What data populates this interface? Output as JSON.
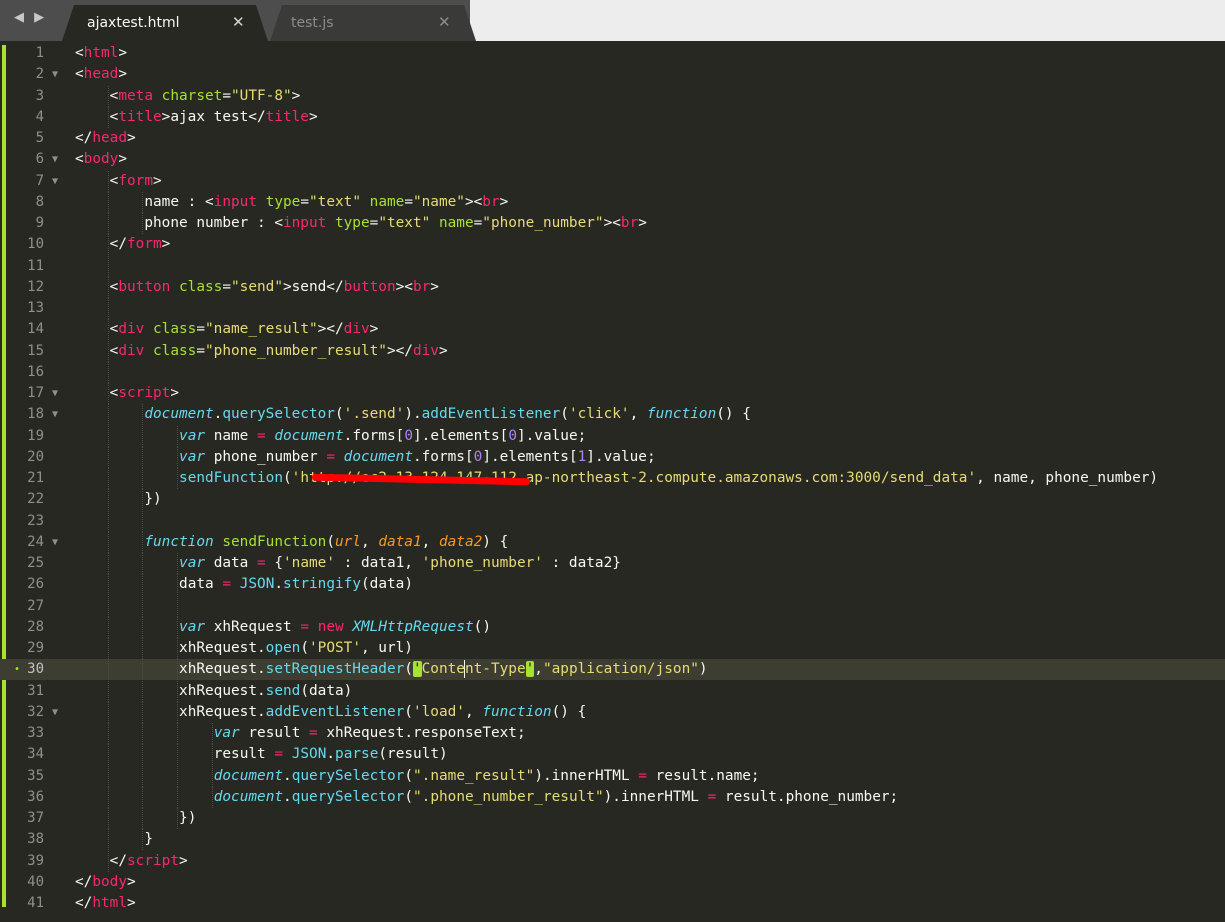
{
  "tabs": [
    {
      "label": "ajaxtest.html",
      "active": true
    },
    {
      "label": "test.js",
      "active": false
    }
  ],
  "nav_arrows": "◀ ▶",
  "close_glyph": "✕",
  "fold_glyph": "▼",
  "modified_glyph": "•",
  "colors": {
    "background": "#272822",
    "tag": "#f92672",
    "attribute": "#a6e22e",
    "string": "#e6db74",
    "keyword": "#66d9ef",
    "parameter": "#fd971f",
    "number": "#ae81ff",
    "text": "#f8f8f2"
  },
  "lines": [
    {
      "n": "1"
    },
    {
      "n": "2"
    },
    {
      "n": "3"
    },
    {
      "n": "4"
    },
    {
      "n": "5"
    },
    {
      "n": "6"
    },
    {
      "n": "7"
    },
    {
      "n": "8"
    },
    {
      "n": "9"
    },
    {
      "n": "10"
    },
    {
      "n": "11"
    },
    {
      "n": "12"
    },
    {
      "n": "13"
    },
    {
      "n": "14"
    },
    {
      "n": "15"
    },
    {
      "n": "16"
    },
    {
      "n": "17"
    },
    {
      "n": "18"
    },
    {
      "n": "19"
    },
    {
      "n": "20"
    },
    {
      "n": "21"
    },
    {
      "n": "22"
    },
    {
      "n": "23"
    },
    {
      "n": "24"
    },
    {
      "n": "25"
    },
    {
      "n": "26"
    },
    {
      "n": "27"
    },
    {
      "n": "28"
    },
    {
      "n": "29"
    },
    {
      "n": "30"
    },
    {
      "n": "31"
    },
    {
      "n": "32"
    },
    {
      "n": "33"
    },
    {
      "n": "34"
    },
    {
      "n": "35"
    },
    {
      "n": "36"
    },
    {
      "n": "37"
    },
    {
      "n": "38"
    },
    {
      "n": "39"
    },
    {
      "n": "40"
    },
    {
      "n": "41"
    }
  ],
  "code": {
    "l1": [
      [
        "p",
        "<"
      ],
      [
        "t",
        "html"
      ],
      [
        "p",
        ">"
      ]
    ],
    "l2": [
      [
        "p",
        "<"
      ],
      [
        "t",
        "head"
      ],
      [
        "p",
        ">"
      ]
    ],
    "l3": [
      [
        "p",
        "<"
      ],
      [
        "t",
        "meta"
      ],
      [
        "p",
        " "
      ],
      [
        "a",
        "charset"
      ],
      [
        "p",
        "="
      ],
      [
        "s",
        "\"UTF-8\""
      ],
      [
        "p",
        ">"
      ]
    ],
    "l4": [
      [
        "p",
        "<"
      ],
      [
        "t",
        "title"
      ],
      [
        "p",
        ">ajax test</"
      ],
      [
        "t",
        "title"
      ],
      [
        "p",
        ">"
      ]
    ],
    "l5": [
      [
        "p",
        "</"
      ],
      [
        "t",
        "head"
      ],
      [
        "p",
        ">"
      ]
    ],
    "l6": [
      [
        "p",
        "<"
      ],
      [
        "t",
        "body"
      ],
      [
        "p",
        ">"
      ]
    ],
    "l7": [
      [
        "p",
        "<"
      ],
      [
        "t",
        "form"
      ],
      [
        "p",
        ">"
      ]
    ],
    "l8": [
      [
        "p",
        "name : <"
      ],
      [
        "t",
        "input"
      ],
      [
        "p",
        " "
      ],
      [
        "a",
        "type"
      ],
      [
        "p",
        "="
      ],
      [
        "s",
        "\"text\""
      ],
      [
        "p",
        " "
      ],
      [
        "a",
        "name"
      ],
      [
        "p",
        "="
      ],
      [
        "s",
        "\"name\""
      ],
      [
        "p",
        "><"
      ],
      [
        "t",
        "br"
      ],
      [
        "p",
        ">"
      ]
    ],
    "l9": [
      [
        "p",
        "phone number : <"
      ],
      [
        "t",
        "input"
      ],
      [
        "p",
        " "
      ],
      [
        "a",
        "type"
      ],
      [
        "p",
        "="
      ],
      [
        "s",
        "\"text\""
      ],
      [
        "p",
        " "
      ],
      [
        "a",
        "name"
      ],
      [
        "p",
        "="
      ],
      [
        "s",
        "\"phone_number\""
      ],
      [
        "p",
        "><"
      ],
      [
        "t",
        "br"
      ],
      [
        "p",
        ">"
      ]
    ],
    "l10": [
      [
        "p",
        "</"
      ],
      [
        "t",
        "form"
      ],
      [
        "p",
        ">"
      ]
    ],
    "l12": [
      [
        "p",
        "<"
      ],
      [
        "t",
        "button"
      ],
      [
        "p",
        " "
      ],
      [
        "a",
        "class"
      ],
      [
        "p",
        "="
      ],
      [
        "s",
        "\"send\""
      ],
      [
        "p",
        ">send</"
      ],
      [
        "t",
        "button"
      ],
      [
        "p",
        "><"
      ],
      [
        "t",
        "br"
      ],
      [
        "p",
        ">"
      ]
    ],
    "l14": [
      [
        "p",
        "<"
      ],
      [
        "t",
        "div"
      ],
      [
        "p",
        " "
      ],
      [
        "a",
        "class"
      ],
      [
        "p",
        "="
      ],
      [
        "s",
        "\"name_result\""
      ],
      [
        "p",
        "></"
      ],
      [
        "t",
        "div"
      ],
      [
        "p",
        ">"
      ]
    ],
    "l15": [
      [
        "p",
        "<"
      ],
      [
        "t",
        "div"
      ],
      [
        "p",
        " "
      ],
      [
        "a",
        "class"
      ],
      [
        "p",
        "="
      ],
      [
        "s",
        "\"phone_number_result\""
      ],
      [
        "p",
        "></"
      ],
      [
        "t",
        "div"
      ],
      [
        "p",
        ">"
      ]
    ],
    "l17": [
      [
        "p",
        "<"
      ],
      [
        "t",
        "script"
      ],
      [
        "p",
        ">"
      ]
    ],
    "l18": [
      [
        "k",
        "document"
      ],
      [
        "p",
        "."
      ],
      [
        "f",
        "querySelector"
      ],
      [
        "p",
        "("
      ],
      [
        "s",
        "'.send'"
      ],
      [
        "p",
        ")."
      ],
      [
        "f",
        "addEventListener"
      ],
      [
        "p",
        "("
      ],
      [
        "s",
        "'click'"
      ],
      [
        "p",
        ", "
      ],
      [
        "k",
        "function"
      ],
      [
        "p",
        "() {"
      ]
    ],
    "l19": [
      [
        "k",
        "var"
      ],
      [
        "p",
        " name "
      ],
      [
        "o",
        "="
      ],
      [
        "p",
        " "
      ],
      [
        "k",
        "document"
      ],
      [
        "p",
        ".forms["
      ],
      [
        "n",
        "0"
      ],
      [
        "p",
        "].elements["
      ],
      [
        "n",
        "0"
      ],
      [
        "p",
        "].value;"
      ]
    ],
    "l20": [
      [
        "k",
        "var"
      ],
      [
        "p",
        " phone_number "
      ],
      [
        "o",
        "="
      ],
      [
        "p",
        " "
      ],
      [
        "k",
        "document"
      ],
      [
        "p",
        ".forms["
      ],
      [
        "n",
        "0"
      ],
      [
        "p",
        "].elements["
      ],
      [
        "n",
        "1"
      ],
      [
        "p",
        "].value;"
      ]
    ],
    "l21": [
      [
        "f",
        "sendFunction"
      ],
      [
        "p",
        "("
      ],
      [
        "s",
        "'http://ec2-13-124-147-112.ap-northeast-2.compute.amazonaws.com:3000/send_data'"
      ],
      [
        "p",
        ", name, phone_number)"
      ]
    ],
    "l22": [
      [
        "p",
        "})"
      ]
    ],
    "l24": [
      [
        "k",
        "function"
      ],
      [
        "p",
        " "
      ],
      [
        "a",
        "sendFunction"
      ],
      [
        "p",
        "("
      ],
      [
        "pa",
        "url"
      ],
      [
        "p",
        ", "
      ],
      [
        "pa",
        "data1"
      ],
      [
        "p",
        ", "
      ],
      [
        "pa",
        "data2"
      ],
      [
        "p",
        ") {"
      ]
    ],
    "l25": [
      [
        "k",
        "var"
      ],
      [
        "p",
        " data "
      ],
      [
        "o",
        "="
      ],
      [
        "p",
        " {"
      ],
      [
        "s",
        "'name'"
      ],
      [
        "p",
        " : data1, "
      ],
      [
        "s",
        "'phone_number'"
      ],
      [
        "p",
        " : data2}"
      ]
    ],
    "l26": [
      [
        "p",
        "data "
      ],
      [
        "o",
        "="
      ],
      [
        "p",
        " "
      ],
      [
        "f",
        "JSON"
      ],
      [
        "p",
        "."
      ],
      [
        "f",
        "stringify"
      ],
      [
        "p",
        "(data)"
      ]
    ],
    "l28": [
      [
        "k",
        "var"
      ],
      [
        "p",
        " xhRequest "
      ],
      [
        "o",
        "="
      ],
      [
        "p",
        " "
      ],
      [
        "o",
        "new"
      ],
      [
        "p",
        " "
      ],
      [
        "k",
        "XMLHttpRequest"
      ],
      [
        "p",
        "()"
      ]
    ],
    "l29": [
      [
        "p",
        "xhRequest."
      ],
      [
        "f",
        "open"
      ],
      [
        "p",
        "("
      ],
      [
        "s",
        "'POST'"
      ],
      [
        "p",
        ", url)"
      ]
    ],
    "l30a": [
      [
        "p",
        "xhRequest."
      ],
      [
        "f",
        "setRequestHeader"
      ],
      [
        "p",
        "("
      ]
    ],
    "l30b": [
      [
        "bh",
        "'"
      ],
      [
        "s",
        "Conte"
      ]
    ],
    "l30c": [
      [
        "s",
        "nt-Type"
      ],
      [
        "bh",
        "'"
      ],
      [
        "p",
        ","
      ],
      [
        "s",
        "\"application/json\""
      ],
      [
        "p",
        ")"
      ]
    ],
    "l31": [
      [
        "p",
        "xhRequest."
      ],
      [
        "f",
        "send"
      ],
      [
        "p",
        "(data)"
      ]
    ],
    "l32": [
      [
        "p",
        "xhRequest."
      ],
      [
        "f",
        "addEventListener"
      ],
      [
        "p",
        "("
      ],
      [
        "s",
        "'load'"
      ],
      [
        "p",
        ", "
      ],
      [
        "k",
        "function"
      ],
      [
        "p",
        "() {"
      ]
    ],
    "l33": [
      [
        "k",
        "var"
      ],
      [
        "p",
        " result "
      ],
      [
        "o",
        "="
      ],
      [
        "p",
        " xhRequest.responseText;"
      ]
    ],
    "l34": [
      [
        "p",
        "result "
      ],
      [
        "o",
        "="
      ],
      [
        "p",
        " "
      ],
      [
        "f",
        "JSON"
      ],
      [
        "p",
        "."
      ],
      [
        "f",
        "parse"
      ],
      [
        "p",
        "(result)"
      ]
    ],
    "l35": [
      [
        "k",
        "document"
      ],
      [
        "p",
        "."
      ],
      [
        "f",
        "querySelector"
      ],
      [
        "p",
        "("
      ],
      [
        "s",
        "\".name_result\""
      ],
      [
        "p",
        ").innerHTML "
      ],
      [
        "o",
        "="
      ],
      [
        "p",
        " result.name;"
      ]
    ],
    "l36": [
      [
        "k",
        "document"
      ],
      [
        "p",
        "."
      ],
      [
        "f",
        "querySelector"
      ],
      [
        "p",
        "("
      ],
      [
        "s",
        "\".phone_number_result\""
      ],
      [
        "p",
        ").innerHTML "
      ],
      [
        "o",
        "="
      ],
      [
        "p",
        " result.phone_number;"
      ]
    ],
    "l37": [
      [
        "p",
        "})"
      ]
    ],
    "l38": [
      [
        "p",
        "}"
      ]
    ],
    "l39": [
      [
        "p",
        "</"
      ],
      [
        "t",
        "script"
      ],
      [
        "p",
        ">"
      ]
    ],
    "l40": [
      [
        "p",
        "</"
      ],
      [
        "t",
        "body"
      ],
      [
        "p",
        ">"
      ]
    ],
    "l41": [
      [
        "p",
        "</"
      ],
      [
        "t",
        "html"
      ],
      [
        "p",
        ">"
      ]
    ]
  }
}
